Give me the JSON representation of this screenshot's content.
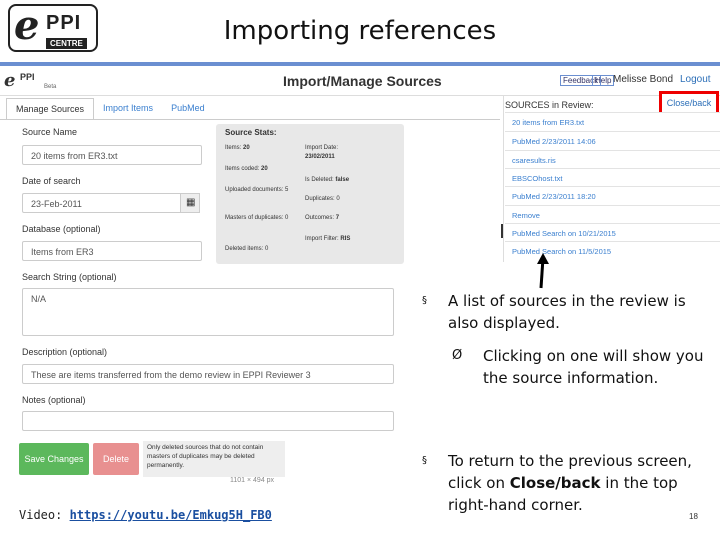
{
  "slide": {
    "title": "Importing references",
    "logo_primary": "e",
    "logo_ppi": "PPI",
    "logo_centre": "CENTRE",
    "ucl_logo": "UCL",
    "page_number": "18",
    "video_caption_prefix": "Video: ",
    "video_link": "https://youtu.be/Emkug5H_FB0"
  },
  "app": {
    "logo_text": "e",
    "logo_ppi": "PPI",
    "logo_beta": "Beta",
    "title": "Import/Manage Sources",
    "feedback": "Feedback",
    "help": "Help",
    "user": "Melisse Bond",
    "logout": "Logout",
    "tabs": [
      {
        "label": "Manage Sources",
        "active": true
      },
      {
        "label": "Import Items",
        "active": false
      },
      {
        "label": "PubMed",
        "active": false
      }
    ]
  },
  "form": {
    "source_name_label": "Source Name",
    "source_name_value": "20 items from ER3.txt",
    "date_label": "Date of search",
    "date_value": "23-Feb-2011",
    "calendar_icon": "calendar-icon",
    "database_label": "Database (optional)",
    "database_value": "Items from ER3",
    "search_label": "Search String (optional)",
    "search_value": "N/A",
    "description_label": "Description (optional)",
    "description_value": "These are items transferred from the demo review in EPPI Reviewer 3",
    "notes_label": "Notes (optional)",
    "notes_value": "",
    "save_button": "Save Changes",
    "delete_button": "Delete",
    "delete_note": "Only deleted sources that do not contain masters of duplicates may be deleted permanently.",
    "cutoff_text": "1101 × 494 px"
  },
  "stats": {
    "title": "Source Stats:",
    "items_label": "Items:",
    "items_value": "20",
    "coded_label": "Items coded:",
    "coded_value": "20",
    "uploaded_label": "Uploaded documents:",
    "uploaded_value": "5",
    "masters_label": "Masters of duplicates:",
    "masters_value": "0",
    "deleted_label": "Deleted items:",
    "deleted_value": "0",
    "import_date_label": "Import Date:",
    "import_date_value": "23/02/2011",
    "is_deleted_label": "Is Deleted:",
    "is_deleted_value": "false",
    "duplicates_label": "Duplicates:",
    "duplicates_value": "0",
    "outcomes_label": "Outcomes:",
    "outcomes_value": "7",
    "import_filter_label": "Import Filter:",
    "import_filter_value": "RIS"
  },
  "sources": {
    "title": "SOURCES in Review:",
    "close_back": "Close/back",
    "items": [
      "20 items from ER3.txt",
      "PubMed 2/23/2011 14:06",
      "csaresults.ris",
      "EBSCOhost.txt",
      "PubMed 2/23/2011 18:20",
      "Remove",
      "PubMed Search on 10/21/2015",
      "PubMed Search on 11/5/2015"
    ]
  },
  "bullets": {
    "b1_symbol": "§",
    "b1": "A list of sources in the review is also displayed.",
    "b2_symbol": "Ø",
    "b2": "Clicking on one will show you the source information.",
    "b3_symbol": "§",
    "b3_prefix": "To return to the previous screen, click on ",
    "b3_bold": "Close/back",
    "b3_suffix": " in the top right-hand corner."
  }
}
